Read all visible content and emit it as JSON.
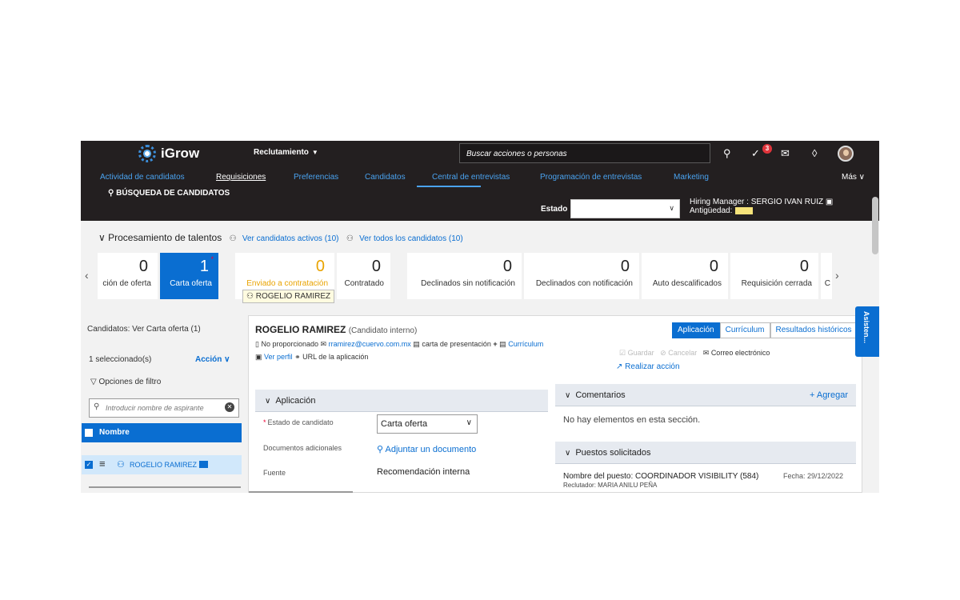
{
  "app": {
    "brand": "iGrow",
    "module": "Reclutamiento",
    "search_placeholder": "Buscar acciones o personas",
    "notif_count": "3"
  },
  "nav": [
    "Actividad de candidatos",
    "Requisiciones",
    "Preferencias",
    "Candidatos",
    "Central de entrevistas",
    "Programación de entrevistas",
    "Marketing"
  ],
  "nav_more": "Más",
  "header": {
    "candidate_search": "BÚSQUEDA DE CANDIDATOS",
    "estado_label": "Estado",
    "hiring_manager": "Hiring Manager : SERGIO IVAN RUIZ",
    "antiguedad": "Antigüedad:"
  },
  "pipeline": {
    "title": "Procesamiento de talentos",
    "link_active": "Ver candidatos activos (10)",
    "link_all": "Ver todos los candidatos (10)",
    "stages": [
      {
        "count": "0",
        "label": "ción de oferta"
      },
      {
        "count": "1",
        "label": "Carta oferta"
      },
      {
        "count": "0",
        "label": "Enviado a contratación"
      },
      {
        "count": "0",
        "label": "Contratado"
      },
      {
        "count": "0",
        "label": "Declinados sin notificación"
      },
      {
        "count": "0",
        "label": "Declinados con notificación"
      },
      {
        "count": "0",
        "label": "Auto descalificados"
      },
      {
        "count": "0",
        "label": "Requisición cerrada"
      },
      {
        "count": "",
        "label": "C"
      }
    ],
    "tooltip": "ROGELIO RAMIREZ"
  },
  "left": {
    "title": "Candidatos: Ver Carta oferta (1)",
    "selected": "1 seleccionado(s)",
    "action": "Acción",
    "filter": "Opciones de filtro",
    "search_placeholder": "Introducir nombre de aspirante",
    "column": "Nombre",
    "candidate": "ROGELIO RAMIREZ"
  },
  "main": {
    "name": "ROGELIO RAMIREZ",
    "type": "(Candidato interno)",
    "no_prop": "No proporcionado",
    "email": "rramirez@cuervo.com.mx",
    "cover": "carta de presentación",
    "cv": "Currículum",
    "profile": "Ver perfil",
    "app_url": "URL de la aplicación",
    "tabs": [
      "Aplicación",
      "Currículum",
      "Resultados históricos"
    ],
    "save": "Guardar",
    "cancel": "Cancelar",
    "email_action": "Correo electrónico",
    "perform": "Realizar acción",
    "sec_app": "Aplicación",
    "estado_label": "Estado de candidato",
    "estado_value": "Carta oferta",
    "docs_label": "Documentos adicionales",
    "docs_link": "Adjuntar un documento",
    "fuente_label": "Fuente",
    "fuente_value": "Recomendación interna",
    "sec_comments": "Comentarios",
    "add": "+ Agregar",
    "no_items": "No hay elementos en esta sección.",
    "sec_positions": "Puestos solicitados",
    "position": "Nombre del puesto: COORDINADOR VISIBILITY (584)",
    "date": "Fecha: 29/12/2022",
    "recruiter": "Reclutador: MARIA ANILU PEÑA"
  },
  "assistant": "Asisten..."
}
